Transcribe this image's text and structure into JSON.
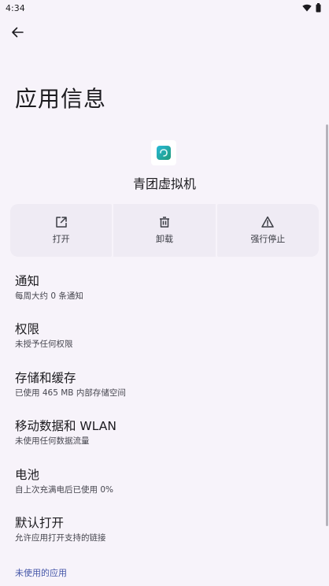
{
  "status_bar": {
    "time": "4:34"
  },
  "page": {
    "title": "应用信息"
  },
  "app": {
    "name": "青团虚拟机"
  },
  "actions": [
    {
      "label": "打开",
      "icon": "open-external-icon"
    },
    {
      "label": "卸载",
      "icon": "trash-icon"
    },
    {
      "label": "强行停止",
      "icon": "warning-icon"
    }
  ],
  "items": [
    {
      "title": "通知",
      "subtitle": "每周大约 0 条通知"
    },
    {
      "title": "权限",
      "subtitle": "未授予任何权限"
    },
    {
      "title": "存储和缓存",
      "subtitle": "已使用 465 MB 内部存储空间"
    },
    {
      "title": "移动数据和 WLAN",
      "subtitle": "未使用任何数据流量"
    },
    {
      "title": "电池",
      "subtitle": "自上次充满电后已使用 0%"
    },
    {
      "title": "默认打开",
      "subtitle": "允许应用打开支持的链接"
    }
  ],
  "section": {
    "unused_apps": "未使用的应用"
  },
  "colors": {
    "background": "#f7f3fa",
    "action_bg": "#efebf4",
    "accent": "#4456a8"
  }
}
